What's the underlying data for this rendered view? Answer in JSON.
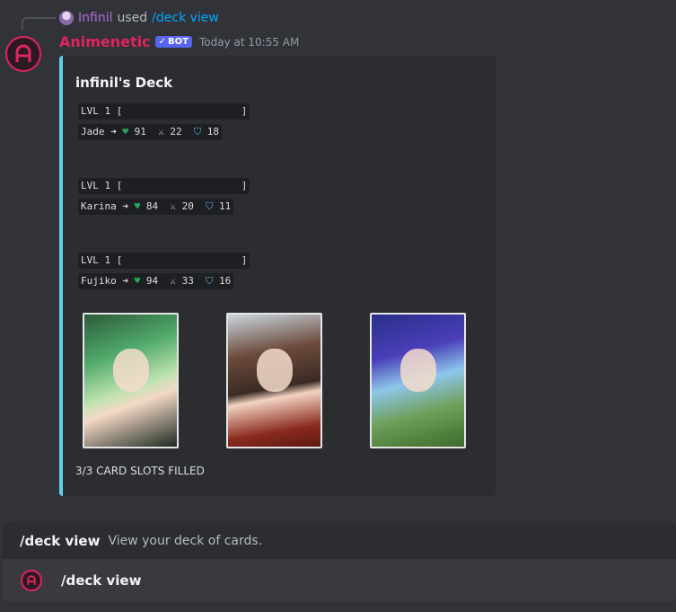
{
  "reply": {
    "user": "Infinil",
    "used": "used",
    "command": "/deck view"
  },
  "message": {
    "author": "Animenetic",
    "bot_tag": "BOT",
    "timestamp": "Today at 10:55 AM"
  },
  "embed": {
    "accent_color": "#5bd1f0",
    "title": "infinil's Deck",
    "cards": [
      {
        "level_line": "LVL 1 [                    ]",
        "name": "Jade",
        "hp": "91",
        "atk": "22",
        "def": "18"
      },
      {
        "level_line": "LVL 1 [                    ]",
        "name": "Karina",
        "hp": "84",
        "atk": "20",
        "def": "11"
      },
      {
        "level_line": "LVL 1 [                    ]",
        "name": "Fujiko",
        "hp": "94",
        "atk": "33",
        "def": "16"
      }
    ],
    "footer": "3/3 CARD SLOTS FILLED"
  },
  "command_bar": {
    "suggest_name": "/deck view",
    "suggest_desc": "View your deck of cards.",
    "input_text": "/deck view"
  },
  "icons": {
    "heart": "green-heart-icon",
    "swords": "crossed-swords-icon",
    "shield": "shield-icon",
    "arrow": "right-arrow-icon"
  }
}
